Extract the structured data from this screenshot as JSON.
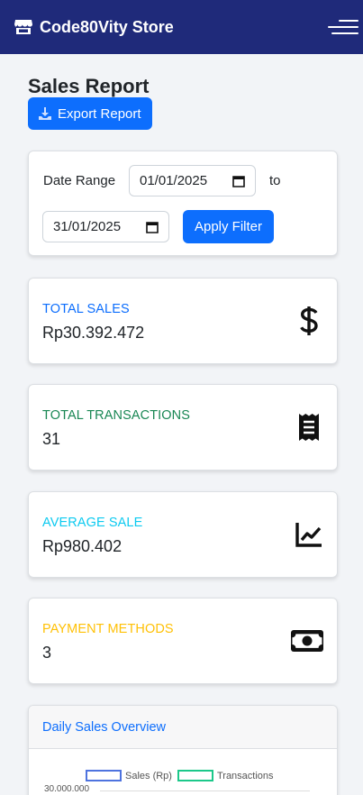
{
  "navbar": {
    "brand": "Code80Vity Store"
  },
  "header": {
    "title": "Sales Report",
    "export_label": "Export Report"
  },
  "filter": {
    "date_range_label": "Date Range",
    "start_date": "01/01/2025",
    "to_label": "to",
    "end_date": "31/01/2025",
    "apply_label": "Apply Filter"
  },
  "stats": [
    {
      "label": "TOTAL SALES",
      "value": "Rp30.392.472",
      "color": "#0d6efd",
      "icon": "dollar-icon"
    },
    {
      "label": "TOTAL TRANSACTIONS",
      "value": "31",
      "color": "#198754",
      "icon": "receipt-icon"
    },
    {
      "label": "AVERAGE SALE",
      "value": "Rp980.402",
      "color": "#0dcaf0",
      "icon": "chart-line-icon"
    },
    {
      "label": "PAYMENT METHODS",
      "value": "3",
      "color": "#ffc107",
      "icon": "money-bill-icon"
    }
  ],
  "chart": {
    "title": "Daily Sales Overview",
    "legend": [
      {
        "name": "Sales (Rp)",
        "color": "#4e73df"
      },
      {
        "name": "Transactions",
        "color": "#1cc88a"
      }
    ],
    "top_tick": "30.000.000"
  }
}
